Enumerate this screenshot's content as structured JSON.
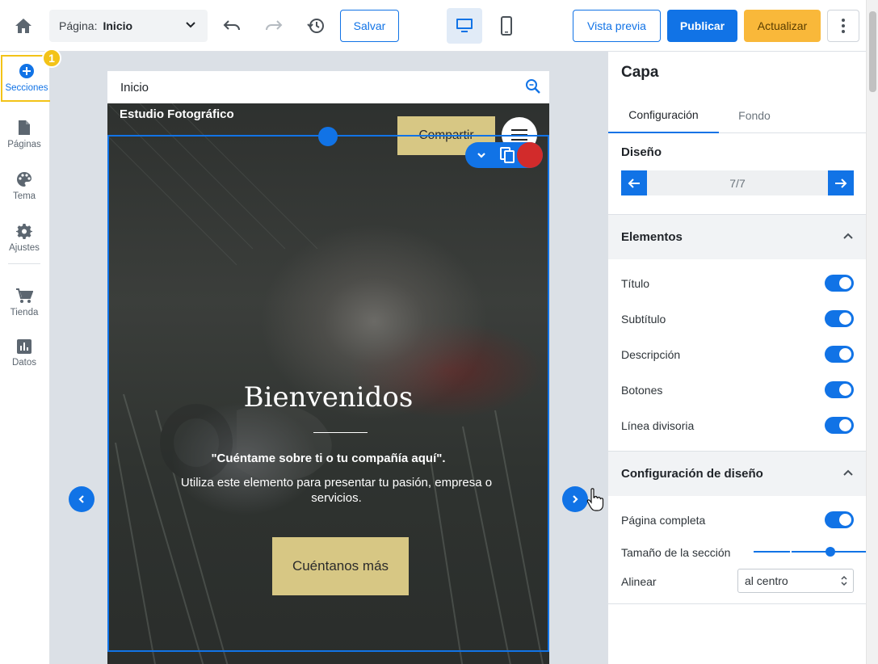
{
  "topbar": {
    "page_label": "Página:",
    "page_value": "Inicio",
    "save_label": "Salvar",
    "preview_label": "Vista previa",
    "publish_label": "Publicar",
    "update_label": "Actualizar",
    "icons": [
      "home-icon",
      "chevron-down-icon",
      "undo-icon",
      "redo-icon",
      "history-icon",
      "desktop-icon",
      "mobile-icon",
      "more-vertical-icon"
    ]
  },
  "sidebar": {
    "badge": "1",
    "items": [
      {
        "label": "Secciones",
        "icon": "plus-circle-icon"
      },
      {
        "label": "Páginas",
        "icon": "page-icon"
      },
      {
        "label": "Tema",
        "icon": "palette-icon"
      },
      {
        "label": "Ajustes",
        "icon": "gear-icon"
      },
      {
        "label": "Tienda",
        "icon": "cart-icon"
      },
      {
        "label": "Datos",
        "icon": "chart-icon"
      }
    ]
  },
  "preview": {
    "header_title": "Inicio",
    "site_name": "Estudio Fotográfico",
    "share_label": "Compartir",
    "hero_title": "Bienvenidos",
    "hero_subtitle": "\"Cuéntame sobre ti o tu compañía aquí\".",
    "hero_description": "Utiliza este elemento para presentar tu pasión, empresa o servicios.",
    "hero_cta": "Cuéntanos más"
  },
  "panel": {
    "title": "Capa",
    "tabs": [
      "Configuración",
      "Fondo"
    ],
    "design_label": "Diseño",
    "design_counter": "7/7",
    "elements_header": "Elementos",
    "elements": [
      {
        "label": "Título",
        "on": true
      },
      {
        "label": "Subtítulo",
        "on": true
      },
      {
        "label": "Descripción",
        "on": true
      },
      {
        "label": "Botones",
        "on": true
      },
      {
        "label": "Línea divisoria",
        "on": true
      }
    ],
    "layout_header": "Configuración de diseño",
    "full_page_label": "Página completa",
    "full_page_on": true,
    "section_size_label": "Tamaño de la sección",
    "section_size_value": 0.66,
    "align_label": "Alinear",
    "align_value": "al centro"
  },
  "colors": {
    "accent": "#1173e6",
    "warning": "#f9b83a",
    "highlight": "#f3c318",
    "hero_button": "#d7c784",
    "delete": "#d22b2b"
  }
}
